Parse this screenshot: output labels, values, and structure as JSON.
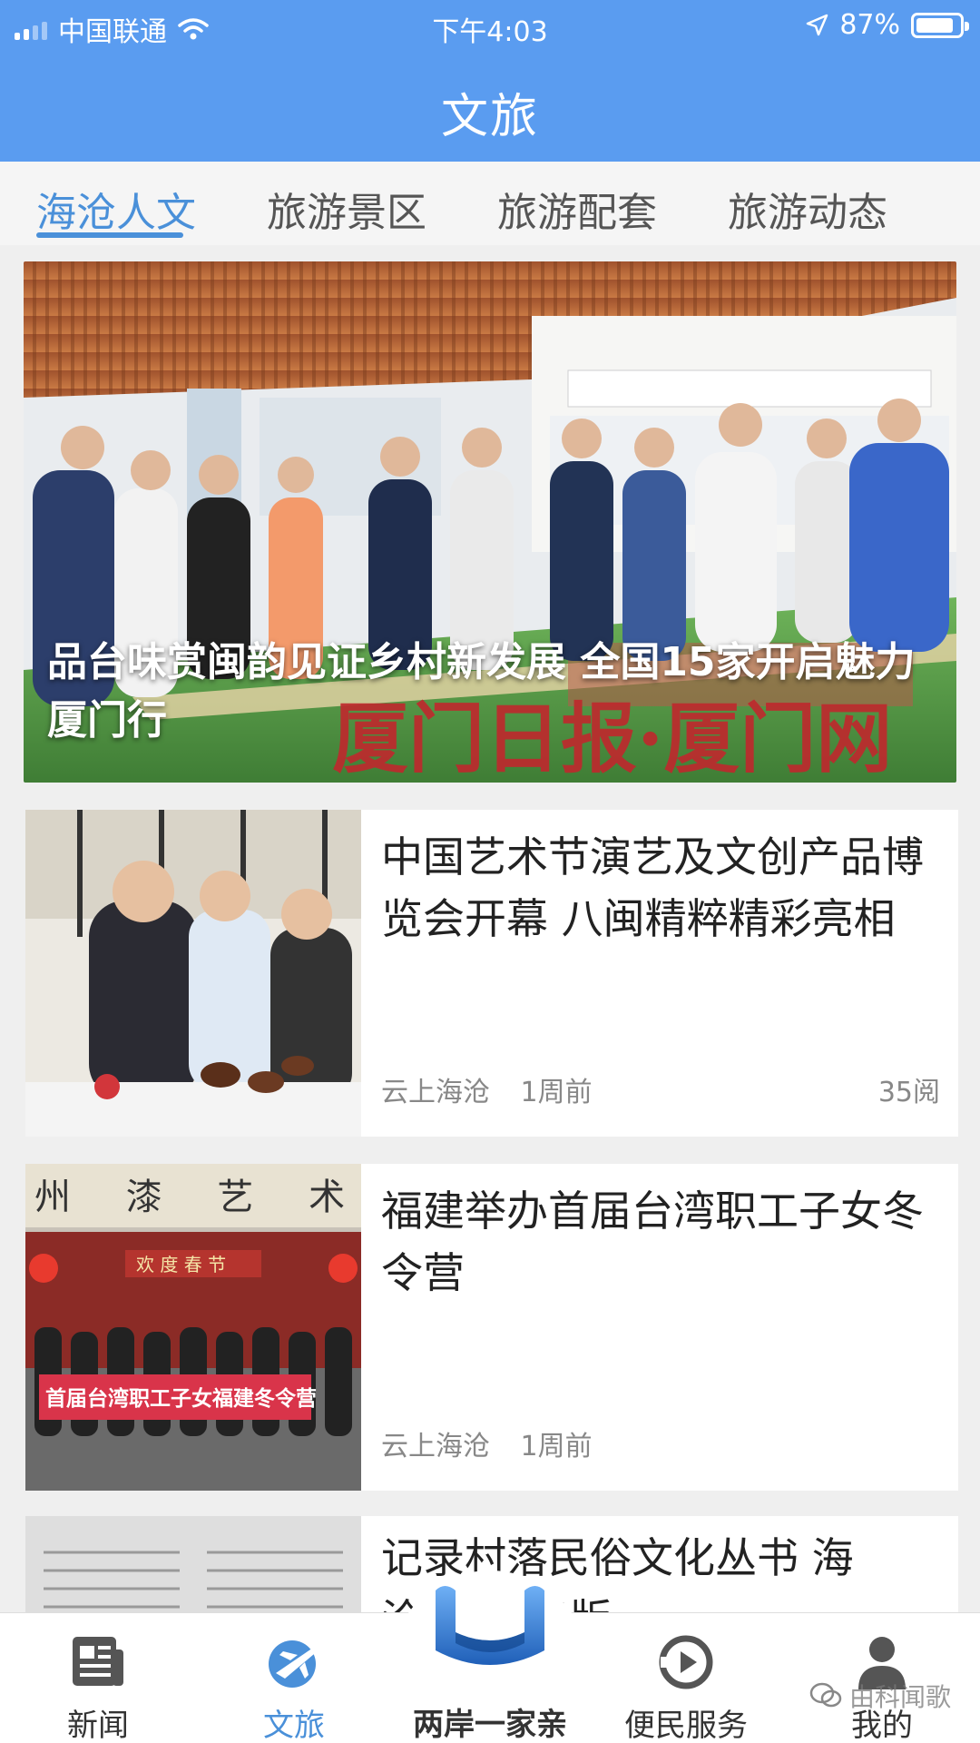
{
  "status_bar": {
    "carrier": "中国联通",
    "time": "下午4:03",
    "battery_percent": "87%",
    "battery_level": 0.87
  },
  "header": {
    "title": "文旅"
  },
  "tabs": [
    {
      "label": "海沧人文",
      "active": true
    },
    {
      "label": "旅游景区",
      "active": false
    },
    {
      "label": "旅游配套",
      "active": false
    },
    {
      "label": "旅游动态",
      "active": false
    }
  ],
  "hero": {
    "title": "品台味赏闽韵见证乡村新发展 全国15家开启魅力厦门行",
    "watermark_text": "厦门日报·厦门网"
  },
  "news": [
    {
      "title": "中国艺术节演艺及文创产品博览会开幕 八闽精粹精彩亮相",
      "source": "云上海沧",
      "time": "1周前",
      "reads": "35阅"
    },
    {
      "title": "福建举办首届台湾职工子女冬令营",
      "source": "云上海沧",
      "time": "1周前",
      "banner_text": "首届台湾职工子女福建冬令营",
      "sign_text": "州 漆 艺 术",
      "gate_text": "欢 度 春 节"
    },
    {
      "title": "记录村落民俗文化丛书 海沧”续集出版"
    }
  ],
  "bottom_nav": [
    {
      "label": "新闻",
      "icon": "newspaper-icon",
      "active": false
    },
    {
      "label": "文旅",
      "icon": "airplane-globe-icon",
      "active": true
    },
    {
      "label": "两岸一家亲",
      "icon": "cross-strait-logo-icon",
      "active": false
    },
    {
      "label": "便民服务",
      "icon": "play-circle-icon",
      "active": false
    },
    {
      "label": "我的",
      "icon": "user-icon",
      "active": false
    }
  ],
  "watermark": "由科闻歌",
  "colors": {
    "primary": "#5a9cf0",
    "accent": "#4a90d9",
    "background": "#efefef"
  }
}
